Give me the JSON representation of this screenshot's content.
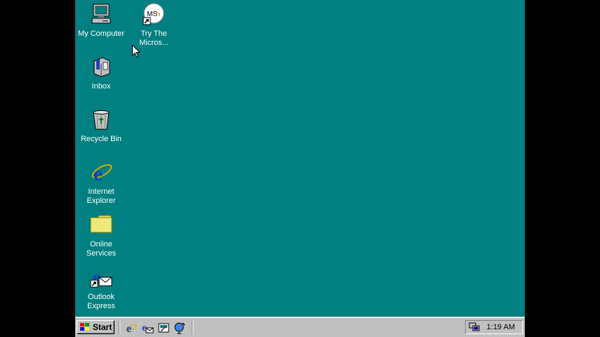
{
  "desktop": {
    "background_color": "#008080",
    "icons": [
      {
        "label": "My Computer",
        "icon": "my-computer-icon"
      },
      {
        "label": "Try The\nMicros...",
        "icon": "msn-icon"
      },
      {
        "label": "Inbox",
        "icon": "inbox-icon"
      },
      {
        "label": "Recycle Bin",
        "icon": "recycle-bin-icon"
      },
      {
        "label": "Internet\nExplorer",
        "icon": "internet-explorer-icon"
      },
      {
        "label": "Online\nServices",
        "icon": "folder-icon"
      },
      {
        "label": "Outlook\nExpress",
        "icon": "outlook-express-icon"
      }
    ]
  },
  "taskbar": {
    "start_label": "Start",
    "quick_launch": [
      "internet-explorer-icon",
      "outlook-express-icon",
      "show-desktop-icon",
      "channels-icon"
    ],
    "clock": "1:19 AM",
    "tray_icon": "network-icon"
  }
}
